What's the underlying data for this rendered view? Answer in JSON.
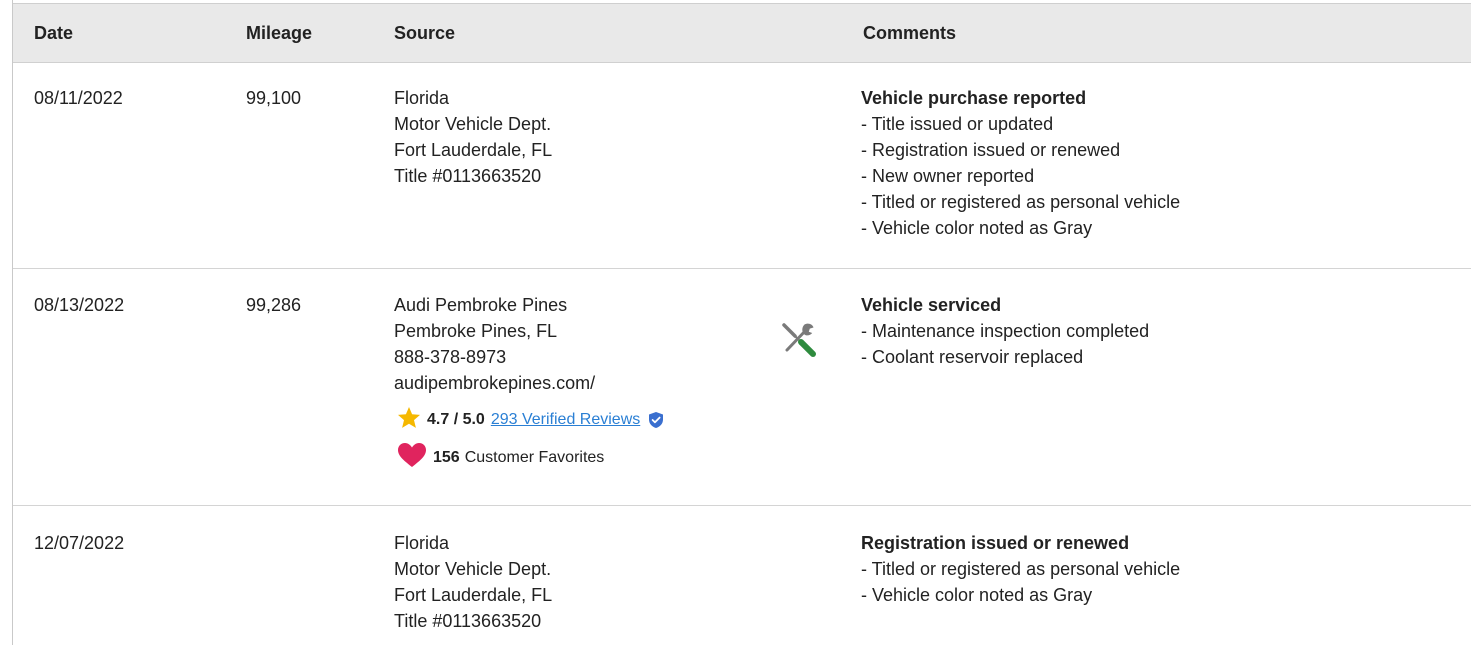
{
  "header": {
    "date": "Date",
    "mileage": "Mileage",
    "source": "Source",
    "comments": "Comments"
  },
  "records": [
    {
      "date": "08/11/2022",
      "mileage": "99,100",
      "source": [
        "Florida",
        "Motor Vehicle Dept.",
        "Fort Lauderdale, FL",
        "Title #0113663520"
      ],
      "comment_title": "Vehicle purchase reported",
      "comment_items": [
        "Title issued or updated",
        "Registration issued or renewed",
        "New owner reported",
        "Titled or registered as personal vehicle",
        "Vehicle color noted as Gray"
      ]
    },
    {
      "date": "08/13/2022",
      "mileage": "99,286",
      "source": [
        "Audi Pembroke Pines",
        "Pembroke Pines, FL",
        "888-378-8973",
        "audipembrokepines.com/"
      ],
      "rating": {
        "score": "4.7 / 5.0",
        "reviews_link": "293 Verified Reviews"
      },
      "favorites": {
        "count": "156",
        "label": "Customer Favorites"
      },
      "icon": "service-tools-icon",
      "comment_title": "Vehicle serviced",
      "comment_items": [
        "Maintenance inspection completed",
        "Coolant reservoir replaced"
      ]
    },
    {
      "date": "12/07/2022",
      "mileage": "",
      "source": [
        "Florida",
        "Motor Vehicle Dept.",
        "Fort Lauderdale, FL",
        "Title #0113663520"
      ],
      "comment_title": "Registration issued or renewed",
      "comment_items": [
        "Titled or registered as personal vehicle",
        "Vehicle color noted as Gray"
      ]
    }
  ],
  "colors": {
    "star": "#f5b800",
    "heart": "#e0245e",
    "link": "#2a7fd4",
    "shield": "#3a6fcf",
    "wrench_handle": "#2e8b3e",
    "tool_gray": "#7a7a7a",
    "header_bg": "#e9e9e9"
  }
}
